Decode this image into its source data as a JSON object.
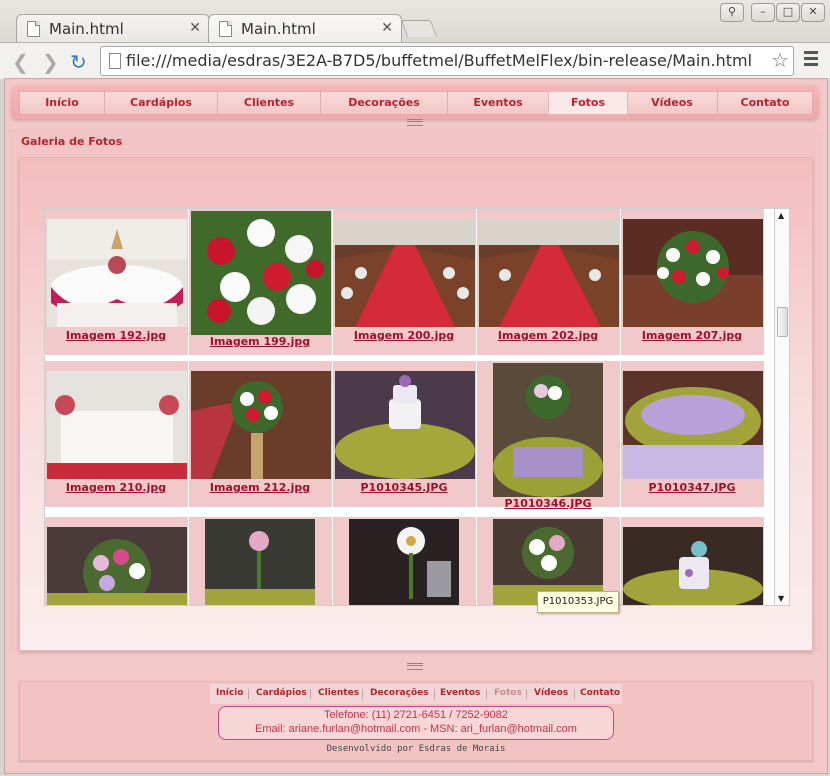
{
  "browser": {
    "tabs": [
      {
        "label": "Main.html"
      },
      {
        "label": "Main.html"
      }
    ],
    "url": "file:///media/esdras/3E2A-B7D5/buffetmel/BuffetMelFlex/bin-release/Main.html"
  },
  "nav": {
    "items": [
      {
        "label": "Início"
      },
      {
        "label": "Cardápios"
      },
      {
        "label": "Clientes"
      },
      {
        "label": "Decorações"
      },
      {
        "label": "Eventos"
      },
      {
        "label": "Fotos",
        "active": true
      },
      {
        "label": "Vídeos"
      },
      {
        "label": "Contato"
      }
    ]
  },
  "gallery": {
    "title": "Galeria de Fotos",
    "row1": [
      "Imagem 192.jpg",
      "Imagem 199.jpg",
      "Imagem 200.jpg",
      "Imagem 202.jpg",
      "Imagem 207.jpg"
    ],
    "row2": [
      "Imagem 210.jpg",
      "Imagem 212.jpg",
      "P1010345.JPG",
      "P1010346.JPG",
      "P1010347.JPG"
    ],
    "tooltip": "P1010353.JPG"
  },
  "footer": {
    "nav": [
      "Início",
      "Cardápios",
      "Clientes",
      "Decorações",
      "Eventos",
      "Fotos",
      "Vídeos",
      "Contato"
    ],
    "phone": "Telefone: (11) 2721-6451 / 7252-9082",
    "email": "Email: ariane.furlan@hotmail.com - MSN: ari_furlan@hotmail.com",
    "developer": "Desenvolvido por Esdras de Morais"
  },
  "colors": {
    "accent": "#b0262e",
    "background": "#f3c8c8"
  },
  "icons": [
    "back-arrow-icon",
    "forward-arrow-icon",
    "reload-icon",
    "page-icon",
    "bookmark-star-icon",
    "menu-icon"
  ]
}
